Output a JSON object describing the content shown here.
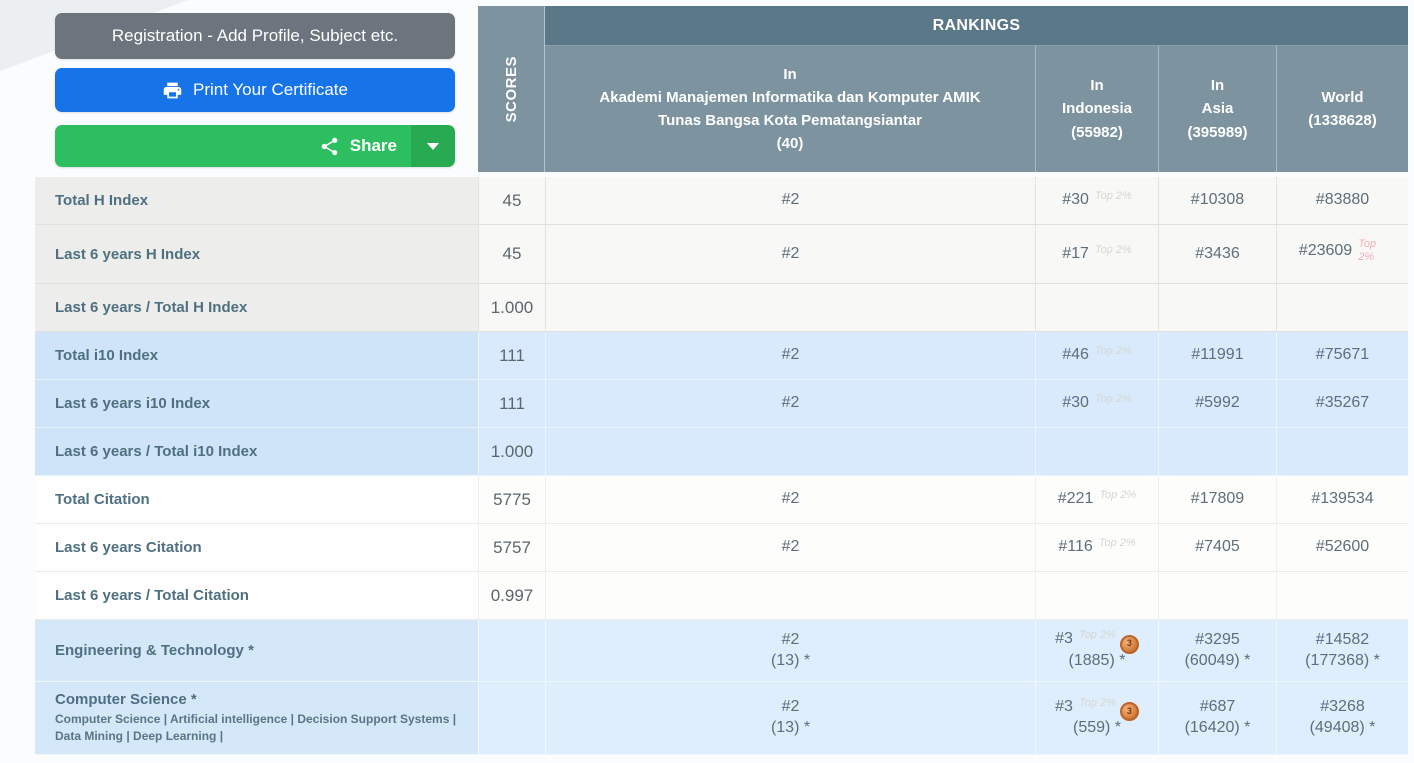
{
  "buttons": {
    "registration_label": "Registration - Add Profile, Subject etc.",
    "print_label": "Print Your Certificate",
    "share_label": "Share"
  },
  "header": {
    "scores": "SCORES",
    "rankings": "RANKINGS",
    "columns": [
      {
        "id": "institution",
        "text": "In\nAkademi Manajemen Informatika dan Komputer AMIK\nTunas Bangsa Kota Pematangsiantar\n(40)"
      },
      {
        "id": "indonesia",
        "text": "In\nIndonesia\n(55982)"
      },
      {
        "id": "asia",
        "text": "In\nAsia\n(395989)"
      },
      {
        "id": "world",
        "text": "World\n(1338628)"
      }
    ]
  },
  "colors": {
    "registration_button": "#6c757d",
    "print_button": "#1673e8",
    "share_button": "#2dbe5f",
    "share_toggle": "#27aa52",
    "header_dark": "#5a7887",
    "header_mid": "#7d93a0",
    "row_blue": "#d9eafc",
    "badge_gray": "#d4d7d1",
    "badge_pink": "#f4adba",
    "medal_bronze": "#c8732f"
  },
  "rows": [
    {
      "label": "Total H Index",
      "score": "45",
      "group": "gray",
      "institution": {
        "rank": "#2"
      },
      "indonesia": {
        "rank": "#30",
        "badge": "Top 2%",
        "badge_style": "gray"
      },
      "asia": {
        "rank": "#10308"
      },
      "world": {
        "rank": "#83880"
      }
    },
    {
      "label": "Last 6 years H Index",
      "score": "45",
      "group": "gray",
      "institution": {
        "rank": "#2"
      },
      "indonesia": {
        "rank": "#17",
        "badge": "Top 2%",
        "badge_style": "gray"
      },
      "asia": {
        "rank": "#3436"
      },
      "world": {
        "rank": "#23609",
        "badge": "Top 2%",
        "badge_style": "pink"
      }
    },
    {
      "label": "Last 6 years / Total H Index",
      "score": "1.000",
      "group": "gray",
      "institution": {},
      "indonesia": {},
      "asia": {},
      "world": {}
    },
    {
      "label": "Total i10 Index",
      "score": "111",
      "group": "blue",
      "institution": {
        "rank": "#2"
      },
      "indonesia": {
        "rank": "#46",
        "badge": "Top 2%",
        "badge_style": "gray"
      },
      "asia": {
        "rank": "#11991"
      },
      "world": {
        "rank": "#75671"
      }
    },
    {
      "label": "Last 6 years i10 Index",
      "score": "111",
      "group": "blue",
      "institution": {
        "rank": "#2"
      },
      "indonesia": {
        "rank": "#30",
        "badge": "Top 2%",
        "badge_style": "gray"
      },
      "asia": {
        "rank": "#5992"
      },
      "world": {
        "rank": "#35267"
      }
    },
    {
      "label": "Last 6 years / Total i10 Index",
      "score": "1.000",
      "group": "blue",
      "institution": {},
      "indonesia": {},
      "asia": {},
      "world": {}
    },
    {
      "label": "Total Citation",
      "score": "5775",
      "group": "white",
      "institution": {
        "rank": "#2"
      },
      "indonesia": {
        "rank": "#221",
        "badge": "Top 2%",
        "badge_style": "gray"
      },
      "asia": {
        "rank": "#17809"
      },
      "world": {
        "rank": "#139534"
      }
    },
    {
      "label": "Last 6 years Citation",
      "score": "5757",
      "group": "white",
      "institution": {
        "rank": "#2"
      },
      "indonesia": {
        "rank": "#116",
        "badge": "Top 2%",
        "badge_style": "gray"
      },
      "asia": {
        "rank": "#7405"
      },
      "world": {
        "rank": "#52600"
      }
    },
    {
      "label": "Last 6 years / Total Citation",
      "score": "0.997",
      "group": "white",
      "institution": {},
      "indonesia": {},
      "asia": {},
      "world": {}
    },
    {
      "label": "Engineering & Technology *",
      "score": "",
      "group": "blue2",
      "institution": {
        "rank": "#2",
        "sub": "(13) *"
      },
      "indonesia": {
        "rank": "#3",
        "badge": "Top 2%",
        "badge_style": "gray",
        "medal": true,
        "sub": "(1885) *"
      },
      "asia": {
        "rank": "#3295",
        "sub": "(60049) *"
      },
      "world": {
        "rank": "#14582",
        "sub": "(177368) *"
      }
    },
    {
      "label": "Computer Science *",
      "sublabel": "Computer Science | Artificial intelligence | Decision Support Systems | Data Mining | Deep Learning |",
      "score": "",
      "group": "blue2",
      "institution": {
        "rank": "#2",
        "sub": "(13) *"
      },
      "indonesia": {
        "rank": "#3",
        "badge": "Top 2%",
        "badge_style": "gray",
        "medal": true,
        "sub": "(559) *"
      },
      "asia": {
        "rank": "#687",
        "sub": "(16420) *"
      },
      "world": {
        "rank": "#3268",
        "sub": "(49408) *"
      }
    }
  ]
}
